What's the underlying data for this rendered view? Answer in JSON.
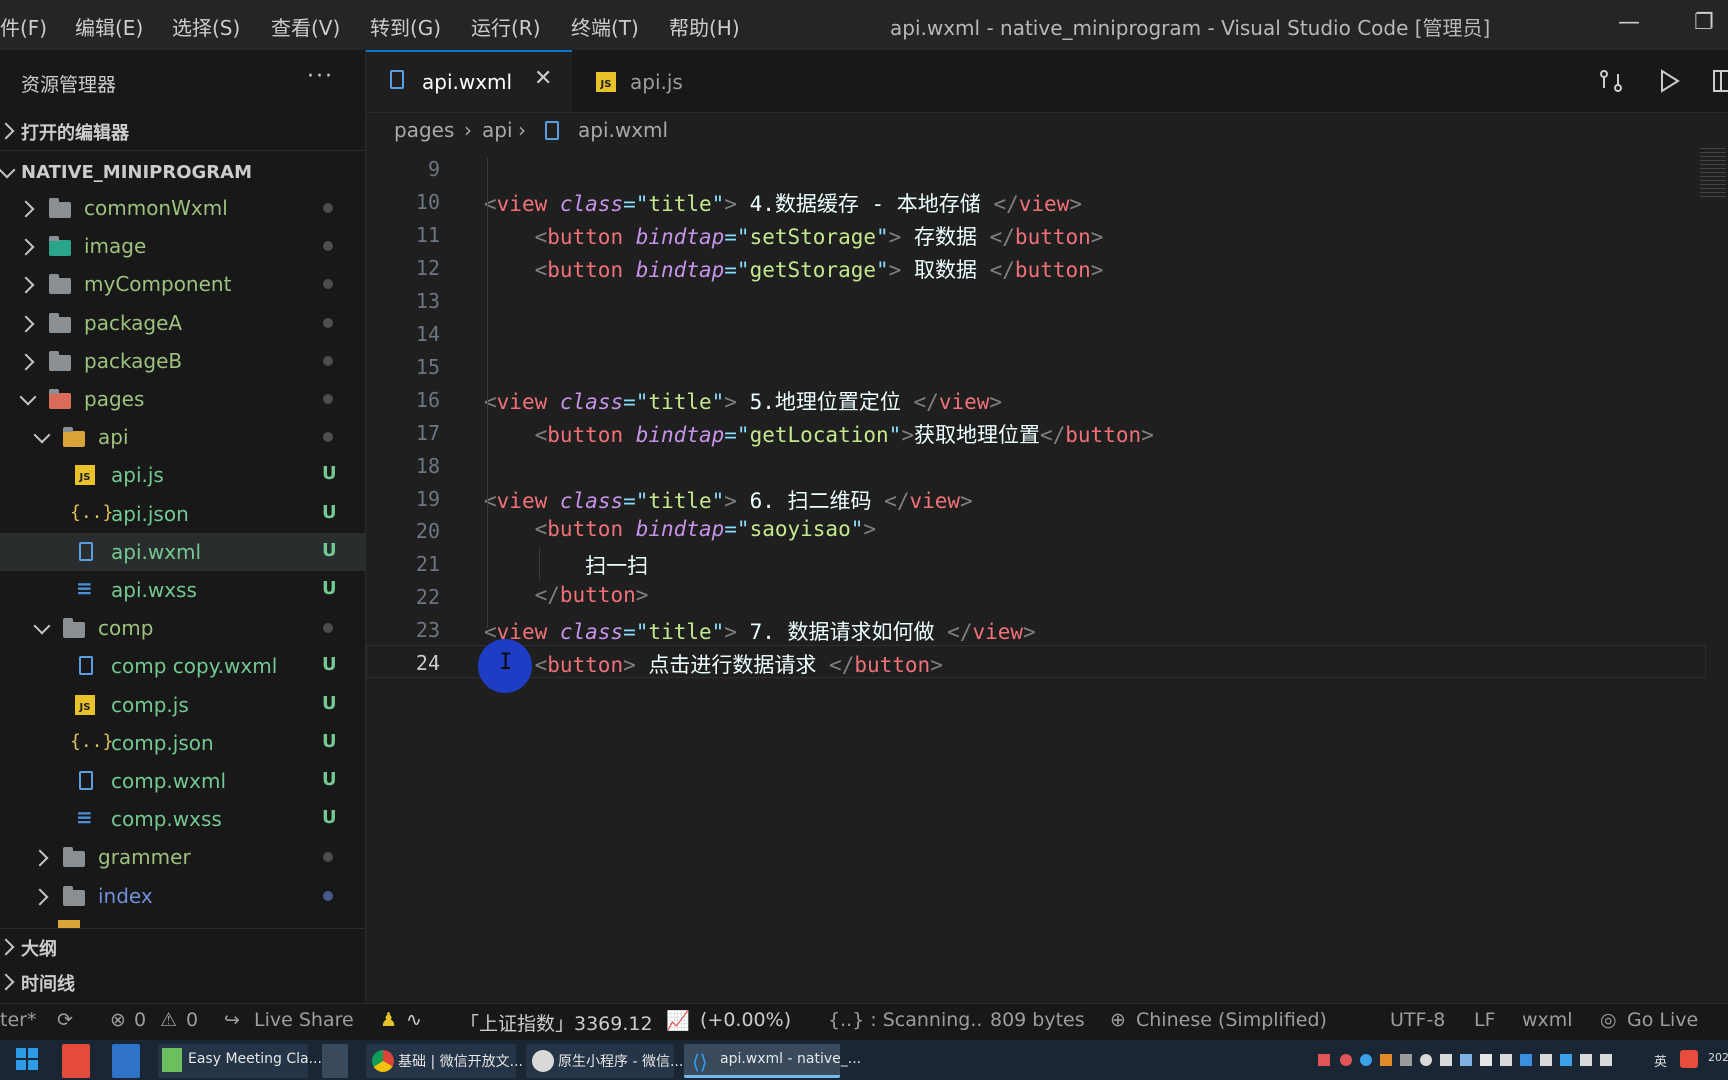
{
  "menu": [
    "件(F)",
    "编辑(E)",
    "选择(S)",
    "查看(V)",
    "转到(G)",
    "运行(R)",
    "终端(T)",
    "帮助(H)"
  ],
  "window_title": "api.wxml - native_miniprogram - Visual Studio Code [管理员]",
  "window_controls": {
    "minimize": "—",
    "restore": "❐"
  },
  "sidebar": {
    "title": "资源管理器",
    "more": "···",
    "open_editors": "打开的编辑器",
    "project": "NATIVE_MINIPROGRAM",
    "outline": "大纲",
    "timeline": "时间线",
    "tree": [
      {
        "label": "commonWxml",
        "type": "folder",
        "depth": 0,
        "expanded": false,
        "status": "dot"
      },
      {
        "label": "image",
        "type": "folder-image",
        "depth": 0,
        "expanded": false,
        "status": "dot"
      },
      {
        "label": "myComponent",
        "type": "folder",
        "depth": 0,
        "expanded": false,
        "status": "dot"
      },
      {
        "label": "packageA",
        "type": "folder",
        "depth": 0,
        "expanded": false,
        "status": "dot"
      },
      {
        "label": "packageB",
        "type": "folder",
        "depth": 0,
        "expanded": false,
        "status": "dot"
      },
      {
        "label": "pages",
        "type": "folder-pages",
        "depth": 0,
        "expanded": true,
        "status": "dot"
      },
      {
        "label": "api",
        "type": "folder-open",
        "depth": 1,
        "expanded": true,
        "status": "dot"
      },
      {
        "label": "api.js",
        "type": "js",
        "depth": 2,
        "status": "U"
      },
      {
        "label": "api.json",
        "type": "json",
        "depth": 2,
        "status": "U"
      },
      {
        "label": "api.wxml",
        "type": "file",
        "depth": 2,
        "status": "U",
        "selected": true
      },
      {
        "label": "api.wxss",
        "type": "css",
        "depth": 2,
        "status": "U"
      },
      {
        "label": "comp",
        "type": "folder-open",
        "depth": 1,
        "expanded": true,
        "status": "dot"
      },
      {
        "label": "comp copy.wxml",
        "type": "file",
        "depth": 2,
        "status": "U"
      },
      {
        "label": "comp.js",
        "type": "js",
        "depth": 2,
        "status": "U"
      },
      {
        "label": "comp.json",
        "type": "json",
        "depth": 2,
        "status": "U"
      },
      {
        "label": "comp.wxml",
        "type": "file",
        "depth": 2,
        "status": "U"
      },
      {
        "label": "comp.wxss",
        "type": "css",
        "depth": 2,
        "status": "U"
      },
      {
        "label": "grammer",
        "type": "folder",
        "depth": 1,
        "expanded": false,
        "status": "dot"
      },
      {
        "label": "index",
        "type": "folder",
        "depth": 1,
        "expanded": false,
        "status": "dot-blue"
      }
    ],
    "colors": {
      "untracked": "#73c991",
      "folder_label": "#9cc27d",
      "index_label": "#6f8fd8"
    }
  },
  "tabs": [
    {
      "label": "api.wxml",
      "active": true,
      "close": "✕"
    },
    {
      "label": "api.js",
      "active": false
    }
  ],
  "breadcrumb": [
    "pages",
    "api",
    "api.wxml"
  ],
  "code_lines": [
    {
      "n": "9",
      "tokens": []
    },
    {
      "n": "10",
      "tokens": [
        [
          "b",
          "<"
        ],
        [
          "tag",
          "view"
        ],
        [
          "s",
          " "
        ],
        [
          "attr",
          "class"
        ],
        [
          "eq",
          "="
        ],
        [
          "q",
          "\""
        ],
        [
          "str",
          "title"
        ],
        [
          "q",
          "\""
        ],
        [
          "b",
          ">"
        ],
        [
          "text",
          " 4.数据缓存 - 本地存储 "
        ],
        [
          "b",
          "</"
        ],
        [
          "tag",
          "view"
        ],
        [
          "b",
          ">"
        ]
      ]
    },
    {
      "n": "11",
      "tokens": [
        [
          "text",
          "    "
        ],
        [
          "b",
          "<"
        ],
        [
          "tag",
          "button"
        ],
        [
          "s",
          " "
        ],
        [
          "attr",
          "bindtap"
        ],
        [
          "eq",
          "="
        ],
        [
          "q",
          "\""
        ],
        [
          "str",
          "setStorage"
        ],
        [
          "q",
          "\""
        ],
        [
          "b",
          ">"
        ],
        [
          "text",
          " 存数据 "
        ],
        [
          "b",
          "</"
        ],
        [
          "tag",
          "button"
        ],
        [
          "b",
          ">"
        ]
      ]
    },
    {
      "n": "12",
      "tokens": [
        [
          "text",
          "    "
        ],
        [
          "b",
          "<"
        ],
        [
          "tag",
          "button"
        ],
        [
          "s",
          " "
        ],
        [
          "attr",
          "bindtap"
        ],
        [
          "eq",
          "="
        ],
        [
          "q",
          "\""
        ],
        [
          "str",
          "getStorage"
        ],
        [
          "q",
          "\""
        ],
        [
          "b",
          ">"
        ],
        [
          "text",
          " 取数据 "
        ],
        [
          "b",
          "</"
        ],
        [
          "tag",
          "button"
        ],
        [
          "b",
          ">"
        ]
      ]
    },
    {
      "n": "13",
      "tokens": []
    },
    {
      "n": "14",
      "tokens": []
    },
    {
      "n": "15",
      "tokens": []
    },
    {
      "n": "16",
      "tokens": [
        [
          "b",
          "<"
        ],
        [
          "tag",
          "view"
        ],
        [
          "s",
          " "
        ],
        [
          "attr",
          "class"
        ],
        [
          "eq",
          "="
        ],
        [
          "q",
          "\""
        ],
        [
          "str",
          "title"
        ],
        [
          "q",
          "\""
        ],
        [
          "b",
          ">"
        ],
        [
          "text",
          " 5.地理位置定位 "
        ],
        [
          "b",
          "</"
        ],
        [
          "tag",
          "view"
        ],
        [
          "b",
          ">"
        ]
      ]
    },
    {
      "n": "17",
      "tokens": [
        [
          "text",
          "    "
        ],
        [
          "b",
          "<"
        ],
        [
          "tag",
          "button"
        ],
        [
          "s",
          " "
        ],
        [
          "attr",
          "bindtap"
        ],
        [
          "eq",
          "="
        ],
        [
          "q",
          "\""
        ],
        [
          "str",
          "getLocation"
        ],
        [
          "q",
          "\""
        ],
        [
          "b",
          ">"
        ],
        [
          "text",
          "获取地理位置"
        ],
        [
          "b",
          "</"
        ],
        [
          "tag",
          "button"
        ],
        [
          "b",
          ">"
        ]
      ]
    },
    {
      "n": "18",
      "tokens": []
    },
    {
      "n": "19",
      "tokens": [
        [
          "b",
          "<"
        ],
        [
          "tag",
          "view"
        ],
        [
          "s",
          " "
        ],
        [
          "attr",
          "class"
        ],
        [
          "eq",
          "="
        ],
        [
          "q",
          "\""
        ],
        [
          "str",
          "title"
        ],
        [
          "q",
          "\""
        ],
        [
          "b",
          ">"
        ],
        [
          "text",
          " 6. 扫二维码 "
        ],
        [
          "b",
          "</"
        ],
        [
          "tag",
          "view"
        ],
        [
          "b",
          ">"
        ]
      ]
    },
    {
      "n": "20",
      "tokens": [
        [
          "text",
          "    "
        ],
        [
          "b",
          "<"
        ],
        [
          "tag",
          "button"
        ],
        [
          "s",
          " "
        ],
        [
          "attr",
          "bindtap"
        ],
        [
          "eq",
          "="
        ],
        [
          "q",
          "\""
        ],
        [
          "str",
          "saoyisao"
        ],
        [
          "q",
          "\""
        ],
        [
          "b",
          ">"
        ]
      ]
    },
    {
      "n": "21",
      "tokens": [
        [
          "text",
          "        扫一扫"
        ]
      ]
    },
    {
      "n": "22",
      "tokens": [
        [
          "text",
          "    "
        ],
        [
          "b",
          "</"
        ],
        [
          "tag",
          "button"
        ],
        [
          "b",
          ">"
        ]
      ]
    },
    {
      "n": "23",
      "tokens": [
        [
          "b",
          "<"
        ],
        [
          "tag",
          "view"
        ],
        [
          "s",
          " "
        ],
        [
          "attr",
          "class"
        ],
        [
          "eq",
          "="
        ],
        [
          "q",
          "\""
        ],
        [
          "str",
          "title"
        ],
        [
          "q",
          "\""
        ],
        [
          "b",
          ">"
        ],
        [
          "text",
          " 7. 数据请求如何做 "
        ],
        [
          "b",
          "</"
        ],
        [
          "tag",
          "view"
        ],
        [
          "b",
          ">"
        ]
      ]
    },
    {
      "n": "24",
      "tokens": [
        [
          "text",
          "    "
        ],
        [
          "b",
          "<"
        ],
        [
          "tag",
          "button"
        ],
        [
          "b",
          ">"
        ],
        [
          "text",
          " 点击进行数据请求 "
        ],
        [
          "b",
          "</"
        ],
        [
          "tag",
          "button"
        ],
        [
          "b",
          ">"
        ]
      ],
      "current": true
    }
  ],
  "status_bar": {
    "branch": "ter*",
    "errors": "0",
    "warnings": "0",
    "live_share": "Live Share",
    "stock_label": "「上证指数」3369.12",
    "stock_change": "(+0.00%)",
    "scanning": "{..} : Scanning..",
    "size": "809 bytes",
    "language_pack": "Chinese (Simplified)",
    "encoding": "UTF-8",
    "eol": "LF",
    "mode": "wxml",
    "go_live": "Go Live"
  },
  "taskbar": {
    "apps": [
      "Easy Meeting Cla...",
      "基础 | 微信开放文...",
      "原生小程序 - 微信...",
      "api.wxml - native_..."
    ],
    "tray_lang": "英",
    "tray_time": "202"
  }
}
